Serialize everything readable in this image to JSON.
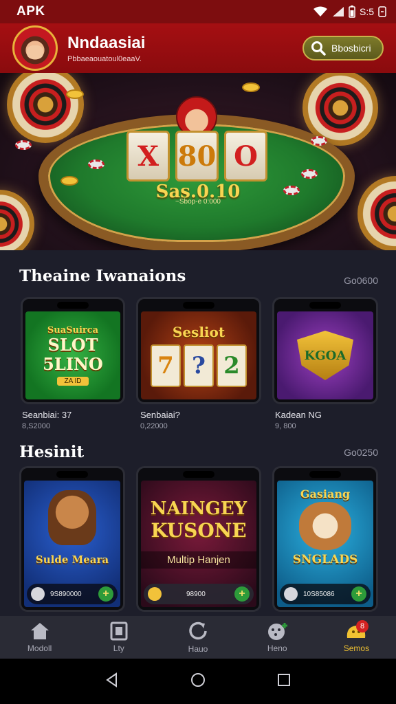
{
  "status_bar": {
    "carrier": "APK",
    "time": "S:5"
  },
  "header": {
    "app_name": "Nndaasiai",
    "tagline": "Pbbaeaouatoul0eaaV.",
    "search_label": "Bbosbicri"
  },
  "hero": {
    "reels": [
      "X",
      "80",
      "O"
    ],
    "amount": "Sas.0.10",
    "subtitle": "~Sbop-e 0:000"
  },
  "section1": {
    "title": "Theaine Iwanaions",
    "more": "Go0600",
    "cards": [
      {
        "screen_title": "SuaSuirca",
        "screen_main": "SLOT 5LINO",
        "screen_badge": "ZA ID",
        "name": "Seanbiai: 37",
        "meta": "8,S2000"
      },
      {
        "screen_title": "Sesliot",
        "reels": [
          "7",
          "?",
          "2"
        ],
        "name": "Senbaiai?",
        "meta": "0,22000"
      },
      {
        "screen_title": "KGOA",
        "name": "Kadean NG",
        "meta": "9, 800"
      }
    ]
  },
  "section2": {
    "title": "Hesinit",
    "more": "Go0250",
    "cards": [
      {
        "caption": "Sulde Meara",
        "bar_text": "9S890000"
      },
      {
        "title_line1": "NAINGEY",
        "title_line2": "KUSONE",
        "caption": "Multip Hanjen",
        "bar_text": "98900"
      },
      {
        "screen_title": "Gasiang",
        "caption": "SNGLADS",
        "bar_text": "10S85086"
      }
    ]
  },
  "nav": {
    "items": [
      {
        "label": "Modoll",
        "icon": "home-icon"
      },
      {
        "label": "Lty",
        "icon": "book-icon"
      },
      {
        "label": "Hauo",
        "icon": "refresh-icon"
      },
      {
        "label": "Heno",
        "icon": "gamepad-icon"
      },
      {
        "label": "Semos",
        "icon": "bonus-icon",
        "badge": "8"
      }
    ],
    "active_index": 4
  },
  "colors": {
    "header": "#9b0e11",
    "accent_gold": "#f1c232",
    "background": "#1d1e2a"
  }
}
